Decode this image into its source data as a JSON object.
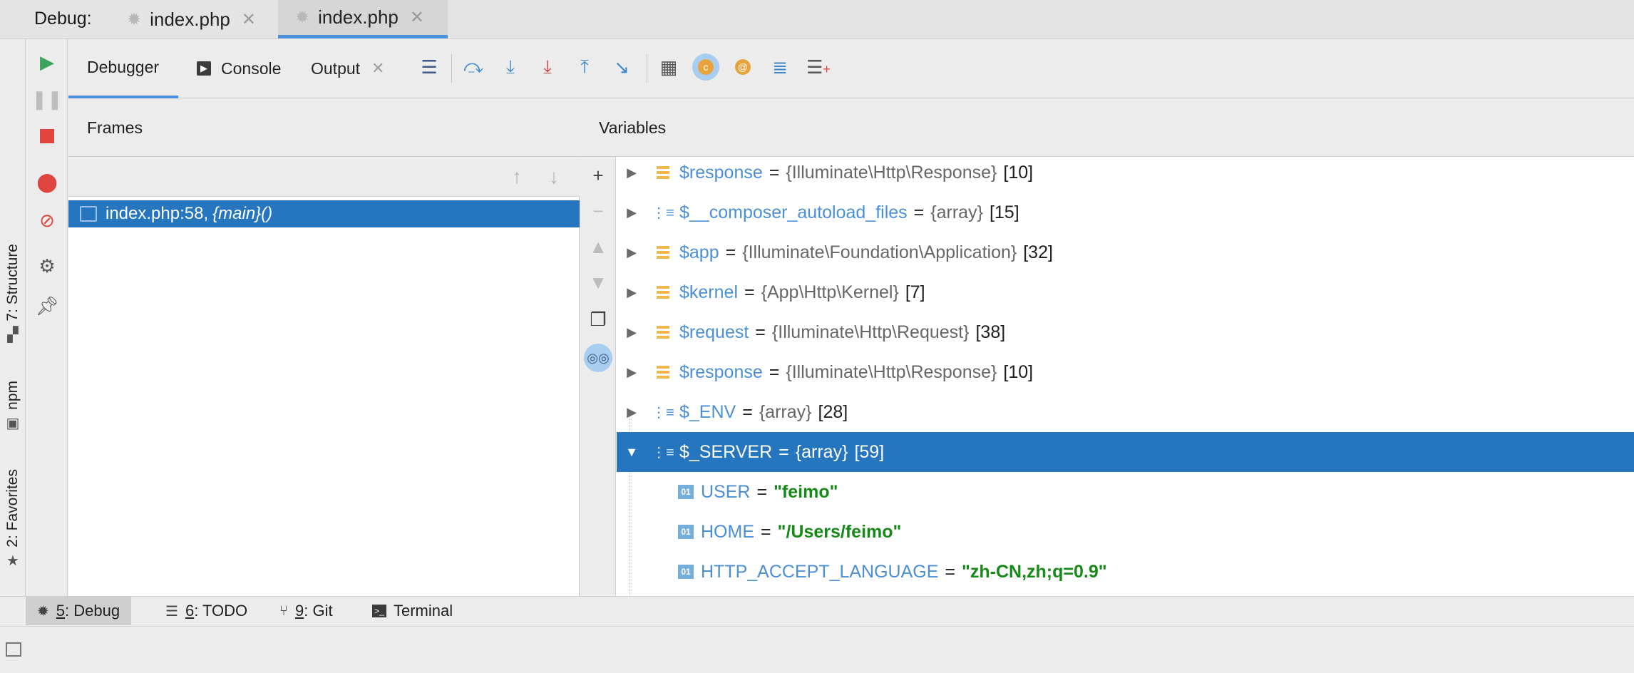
{
  "debug_bar": {
    "label": "Debug:",
    "tabs": [
      {
        "label": "index.php",
        "active": false
      },
      {
        "label": "index.php",
        "active": true
      }
    ]
  },
  "left_stripe": {
    "structure": "7: Structure",
    "npm": "npm",
    "favorites": "2: Favorites"
  },
  "tool_tabs": {
    "debugger": "Debugger",
    "console": "Console",
    "output": "Output"
  },
  "frames": {
    "title": "Frames",
    "selected_frame_location": "index.php:58,",
    "selected_frame_function": "{main}()"
  },
  "variables": {
    "title": "Variables",
    "rows": [
      {
        "name": "$response",
        "type": "{Illuminate\\Http\\Response}",
        "count": "[10]",
        "icon": "object-icon"
      },
      {
        "name": "$__composer_autoload_files",
        "type": "{array}",
        "count": "[15]",
        "icon": "array-icon"
      },
      {
        "name": "$app",
        "type": "{Illuminate\\Foundation\\Application}",
        "count": "[32]",
        "icon": "object-icon"
      },
      {
        "name": "$kernel",
        "type": "{App\\Http\\Kernel}",
        "count": "[7]",
        "icon": "object-icon"
      },
      {
        "name": "$request",
        "type": "{Illuminate\\Http\\Request}",
        "count": "[38]",
        "icon": "object-icon"
      },
      {
        "name": "$response",
        "type": "{Illuminate\\Http\\Response}",
        "count": "[10]",
        "icon": "object-icon"
      },
      {
        "name": "$_ENV",
        "type": "{array}",
        "count": "[28]",
        "icon": "array-icon"
      },
      {
        "name": "$_SERVER",
        "type": "{array}",
        "count": "[59]",
        "icon": "array-icon",
        "selected": true,
        "expanded": true
      }
    ],
    "server_children": [
      {
        "badge": "01",
        "name": "USER",
        "value": "\"feimo\""
      },
      {
        "badge": "01",
        "name": "HOME",
        "value": "\"/Users/feimo\""
      },
      {
        "badge": "01",
        "name": "HTTP_ACCEPT_LANGUAGE",
        "value": "\"zh-CN,zh;q=0.9\""
      }
    ]
  },
  "bottom_tabs": {
    "debug_num": "5",
    "debug_label": ": Debug",
    "todo_num": "6",
    "todo_label": ": TODO",
    "git_num": "9",
    "git_label": ": Git",
    "terminal": "Terminal"
  },
  "colors": {
    "accent": "#4a8fd8",
    "selection": "#2675bf",
    "string_value": "#168a16",
    "stop_red": "#e0443e",
    "resume_green": "#3aa35c"
  }
}
